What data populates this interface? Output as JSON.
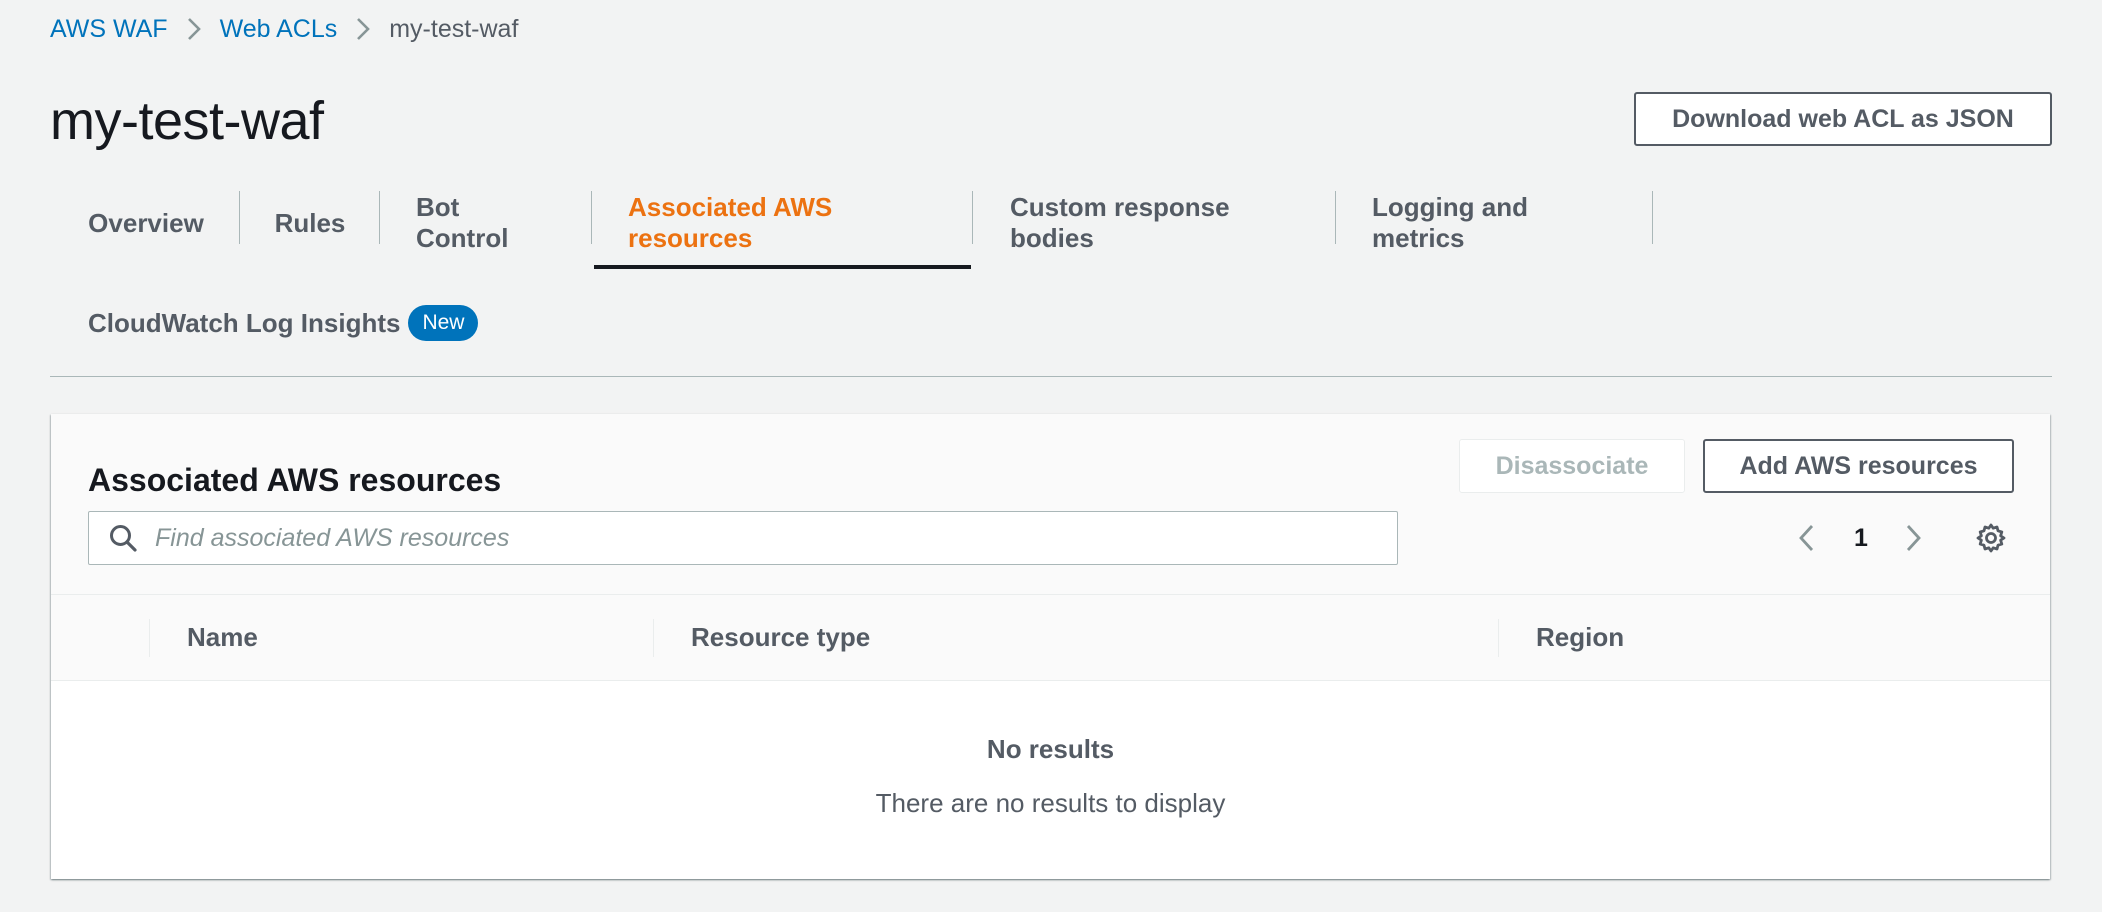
{
  "breadcrumb": {
    "items": [
      "AWS WAF",
      "Web ACLs"
    ],
    "current": "my-test-waf"
  },
  "page": {
    "title": "my-test-waf",
    "download_label": "Download web ACL as JSON"
  },
  "tabs": {
    "items": [
      {
        "label": "Overview"
      },
      {
        "label": "Rules"
      },
      {
        "label": "Bot Control"
      },
      {
        "label": "Associated AWS resources",
        "active": true
      },
      {
        "label": "Custom response bodies"
      },
      {
        "label": "Logging and metrics"
      },
      {
        "label": "CloudWatch Log Insights",
        "badge": "New"
      }
    ]
  },
  "panel": {
    "title": "Associated AWS resources",
    "disassociate_label": "Disassociate",
    "add_label": "Add AWS resources",
    "search_placeholder": "Find associated AWS resources",
    "search_value": "",
    "page_number": "1",
    "columns": [
      "Name",
      "Resource type",
      "Region"
    ],
    "empty_title": "No results",
    "empty_description": "There are no results to display"
  },
  "colors": {
    "link": "#0073bb",
    "active_tab": "#ec7211",
    "badge": "#0073bb",
    "text": "#16191f",
    "muted": "#545b64"
  },
  "icons": [
    "chevron-right-icon",
    "search-icon",
    "chevron-left-icon",
    "gear-icon"
  ]
}
